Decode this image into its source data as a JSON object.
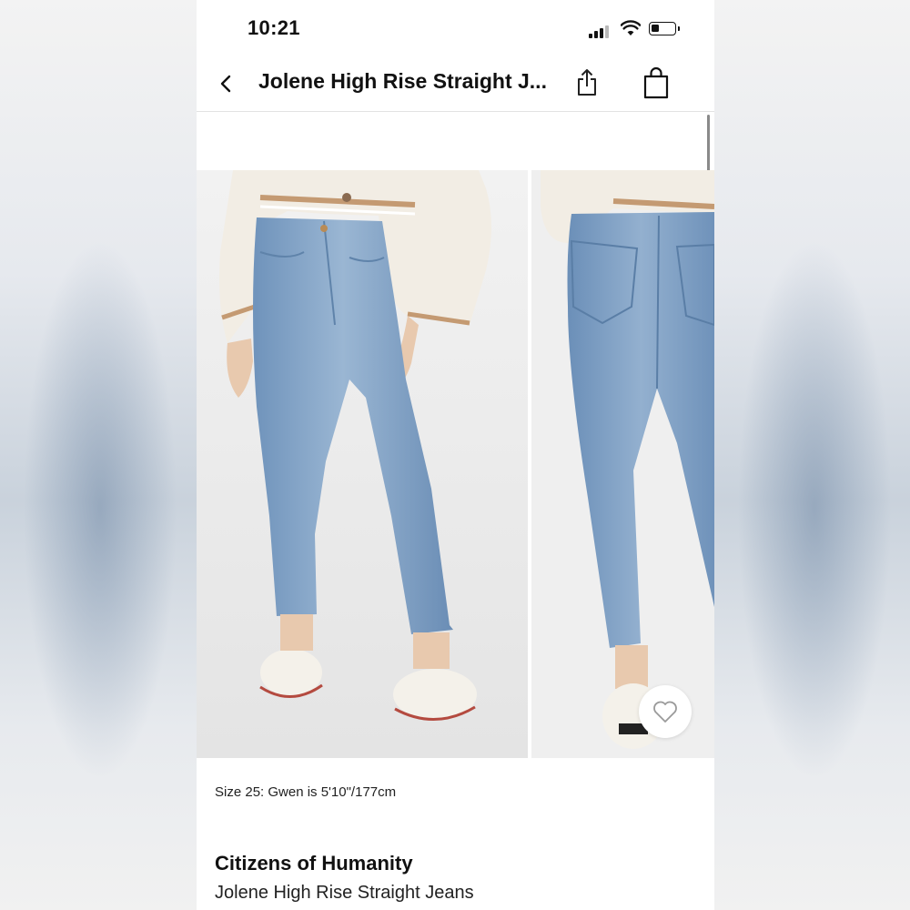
{
  "status_bar": {
    "time": "10:21",
    "signal_bars_active": 3,
    "signal_bars_total": 4,
    "battery_level": 0.35
  },
  "nav": {
    "back_icon": "chevron-left-icon",
    "title": "Jolene High Rise Straight J...",
    "share_icon": "share-icon",
    "bag_icon": "shopping-bag-icon"
  },
  "gallery": {
    "images": [
      {
        "view": "front",
        "icon": "product-photo-front"
      },
      {
        "view": "back",
        "icon": "product-photo-back"
      }
    ],
    "favorite_icon": "heart-outline-icon"
  },
  "product": {
    "size_caption": "Size 25: Gwen is 5'10\"/177cm",
    "brand": "Citizens of Humanity",
    "name": "Jolene High Rise Straight Jeans"
  },
  "colors": {
    "denim": "#7b9dc2",
    "sweater": "#f2ede4",
    "sweater_stripe": "#c49a72",
    "text": "#111111"
  }
}
